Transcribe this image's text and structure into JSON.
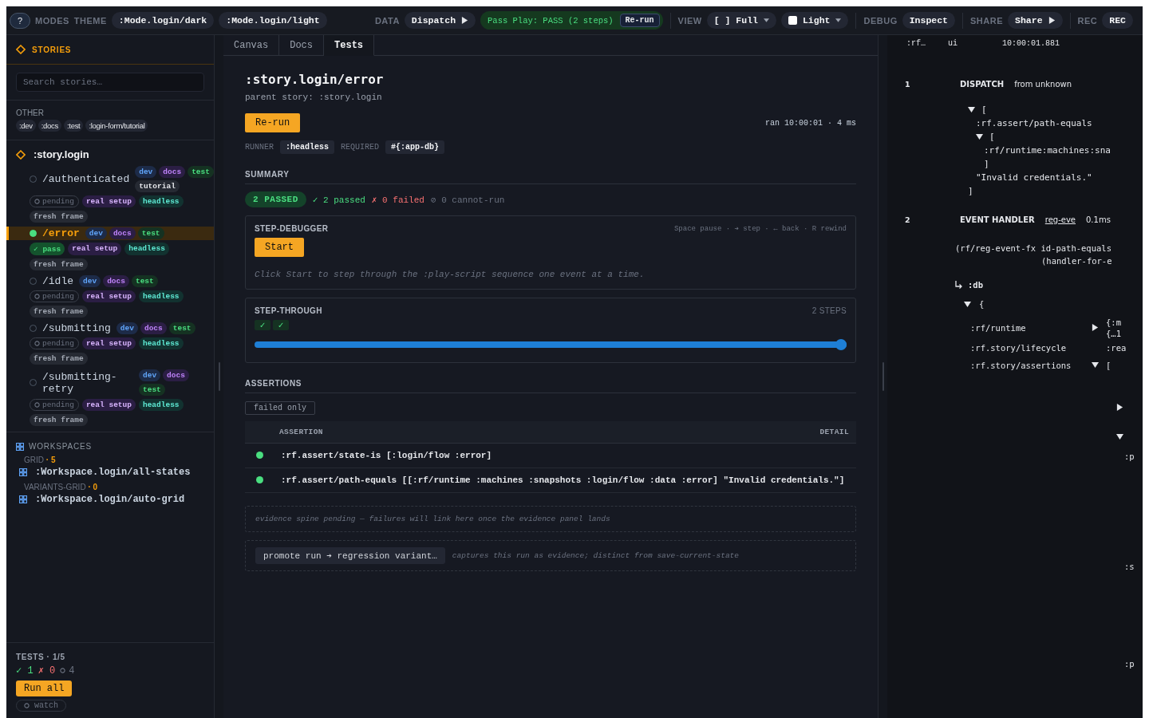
{
  "topbar": {
    "help": "?",
    "modes_label": "MODES",
    "theme_label": "THEME",
    "themes": [
      ":Mode.login/dark",
      ":Mode.login/light"
    ],
    "data_label": "DATA",
    "dispatch": "Dispatch",
    "play_status": "Pass Play: PASS (2 steps)",
    "play_rerun": "Re-run",
    "view_label": "VIEW",
    "view_size": "[ ] Full",
    "theme_toggle": {
      "label": "Light",
      "checked": false
    },
    "debug_label": "DEBUG",
    "inspect": "Inspect",
    "share_label": "SHARE",
    "share": "Share",
    "rec_label": "REC",
    "rec": "REC"
  },
  "sidebar": {
    "title": "STORIES",
    "search_placeholder": "Search stories…",
    "other_label": "OTHER",
    "other_tags": [
      ":dev",
      ":docs",
      ":test",
      ":login-form/tutorial"
    ],
    "story": {
      "name": ":story.login",
      "variants": [
        {
          "name": "/authenticated",
          "selected": false,
          "passed": false,
          "status_label": "pending",
          "tags": [
            {
              "label": "dev",
              "kind": "dev"
            },
            {
              "label": "docs",
              "kind": "docs"
            },
            {
              "label": "test",
              "kind": "test"
            },
            {
              "label": "tutorial",
              "kind": "plain"
            }
          ],
          "badges": [
            {
              "label": "real setup",
              "kind": "setup"
            },
            {
              "label": "headless",
              "kind": "runner"
            },
            {
              "label": "fresh frame",
              "kind": "plain"
            }
          ]
        },
        {
          "name": "/error",
          "selected": true,
          "passed": true,
          "status_label": "✓ pass",
          "tags": [
            {
              "label": "dev",
              "kind": "dev"
            },
            {
              "label": "docs",
              "kind": "docs"
            },
            {
              "label": "test",
              "kind": "test"
            }
          ],
          "badges": [
            {
              "label": "real setup",
              "kind": "setup"
            },
            {
              "label": "headless",
              "kind": "runner"
            },
            {
              "label": "fresh frame",
              "kind": "plain"
            }
          ]
        },
        {
          "name": "/idle",
          "selected": false,
          "passed": false,
          "status_label": "pending",
          "tags": [
            {
              "label": "dev",
              "kind": "dev"
            },
            {
              "label": "docs",
              "kind": "docs"
            },
            {
              "label": "test",
              "kind": "test"
            }
          ],
          "badges": [
            {
              "label": "real setup",
              "kind": "setup"
            },
            {
              "label": "headless",
              "kind": "runner"
            },
            {
              "label": "fresh frame",
              "kind": "plain"
            }
          ]
        },
        {
          "name": "/submitting",
          "selected": false,
          "passed": false,
          "status_label": "pending",
          "tags": [
            {
              "label": "dev",
              "kind": "dev"
            },
            {
              "label": "docs",
              "kind": "docs"
            },
            {
              "label": "test",
              "kind": "test"
            }
          ],
          "badges": [
            {
              "label": "real setup",
              "kind": "setup"
            },
            {
              "label": "headless",
              "kind": "runner"
            },
            {
              "label": "fresh frame",
              "kind": "plain"
            }
          ]
        },
        {
          "name": "/submitting-retry",
          "selected": false,
          "passed": false,
          "status_label": "pending",
          "tags": [
            {
              "label": "dev",
              "kind": "dev"
            },
            {
              "label": "docs",
              "kind": "docs"
            },
            {
              "label": "test",
              "kind": "test"
            }
          ],
          "badges": [
            {
              "label": "real setup",
              "kind": "setup"
            },
            {
              "label": "headless",
              "kind": "runner"
            },
            {
              "label": "fresh frame",
              "kind": "plain"
            }
          ]
        }
      ]
    },
    "workspaces": {
      "title": "WORKSPACES",
      "groups": [
        {
          "label": "GRID",
          "count": "· 5",
          "items": [
            ":Workspace.login/all-states"
          ]
        },
        {
          "label": "VARIANTS-GRID",
          "count": "· 0",
          "items": [
            ":Workspace.login/auto-grid"
          ]
        }
      ]
    },
    "tests": {
      "title": "TESTS · 1/5",
      "passed": "✓ 1",
      "failed": "✗ 0",
      "pending": "4",
      "run_all": "Run all",
      "watch": "watch"
    }
  },
  "main": {
    "tabs": [
      {
        "label": "Canvas",
        "selected": false
      },
      {
        "label": "Docs",
        "selected": false
      },
      {
        "label": "Tests",
        "selected": true
      }
    ],
    "title": ":story.login/error",
    "parent": "parent story: :story.login",
    "rerun": "Re-run",
    "ran": "ran 10:00:01 · 4 ms",
    "runner_label": "RUNNER",
    "runner": ":headless",
    "required_label": "REQUIRED",
    "required": "#{:app-db}",
    "summary": {
      "title": "SUMMARY",
      "badge": "2 PASSED",
      "passed": "✓ 2 passed",
      "failed": "✗ 0 failed",
      "cannot_run": "⊘ 0 cannot-run"
    },
    "step_debugger": {
      "title": "STEP-DEBUGGER",
      "keys": "Space pause · ➔ step · ← back · R rewind",
      "start": "Start",
      "note": "Click Start to step through the :play-script sequence one event at a time."
    },
    "step_through": {
      "title": "STEP-THROUGH",
      "count": "2 STEPS",
      "steps": [
        "✓",
        "✓"
      ],
      "level": 1
    },
    "assertions": {
      "title": "ASSERTIONS",
      "filter": "failed only",
      "columns": [
        "ASSERTION",
        "DETAIL"
      ],
      "rows": [
        {
          "text": ":rf.assert/state-is [:login/flow :error]",
          "passed": true
        },
        {
          "text": ":rf.assert/path-equals [[:rf/runtime :machines :snapshots :login/flow :data :error] \"Invalid credentials.\"]",
          "passed": true
        }
      ]
    },
    "evidence_note": "evidence spine pending — failures will link here once the evidence panel lands",
    "promote": "promote run ➔ regression variant…",
    "promote_note": "captures this run as evidence; distinct from save-current-state"
  },
  "inspector": {
    "header": [
      ":rf…",
      "ui",
      "10:00:01.881"
    ],
    "entries": [
      {
        "kind": "dispatch",
        "index": "1",
        "label": "DISPATCH",
        "source": "from unknown",
        "tree": [
          {
            "text": "[",
            "expanded": true,
            "children": [
              {
                "text": ":rf.assert/path-equals"
              },
              {
                "text": "[",
                "expanded": true,
                "children": [
                  {
                    "text": ":rf/runtime:machines:sna"
                  },
                  {
                    "text": "]"
                  }
                ]
              },
              {
                "text": "\"Invalid credentials.\""
              }
            ]
          },
          {
            "text": "]"
          }
        ]
      },
      {
        "kind": "handler",
        "index": "2",
        "label": "EVENT HANDLER",
        "link": "reg-eve",
        "time": "0.1ms",
        "code": [
          "(rf/reg-event-fx id-path-equals",
          "(handler-for-e"
        ],
        "db_label": ":db",
        "db": {
          "text": "{",
          "expanded": true,
          "entries": [
            {
              "key": ":rf/runtime",
              "expanded": false,
              "values": [
                "{:m",
                "{…1"
              ]
            },
            {
              "key": ":rf.story/lifecycle",
              "values": [
                ":rea"
              ]
            },
            {
              "key": ":rf.story/assertions",
              "expanded": true,
              "values": [
                "["
              ]
            }
          ]
        },
        "overflow": [
          {
            "expanded": false
          },
          {
            "expanded": true
          },
          {
            "text": ":p"
          },
          {
            "text": ":s"
          },
          {
            "text": ":p"
          }
        ]
      }
    ]
  }
}
